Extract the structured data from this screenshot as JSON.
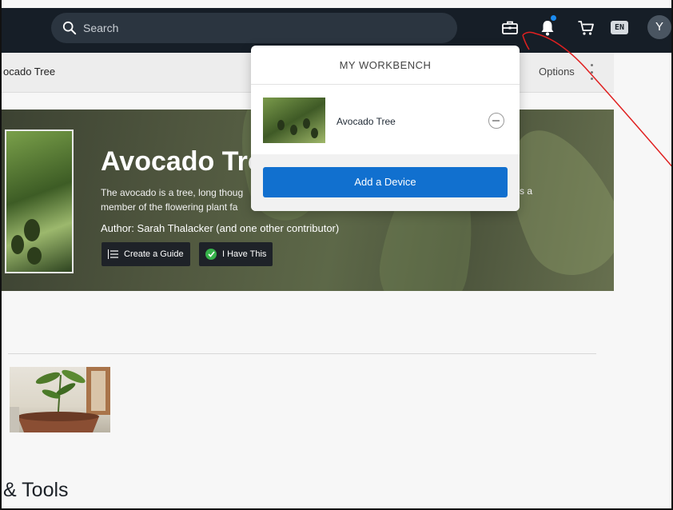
{
  "header": {
    "search_placeholder": "Search",
    "icons": [
      "search-icon",
      "toolbox-icon",
      "bell-icon",
      "cart-icon"
    ],
    "notification_dot_color": "#1b8bf0",
    "language": "EN",
    "avatar_initial": "Y"
  },
  "subbar": {
    "breadcrumb": "ocado Tree",
    "options_label": "Options"
  },
  "hero": {
    "title": "Avocado Tre",
    "description_line1": "The avocado is a tree, long thoug",
    "description_line2": "member of the flowering plant fa",
    "description_tail": "s a",
    "author": "Author: Sarah Thalacker (and one other contributor)",
    "create_guide_label": "Create a Guide",
    "have_this_label": "I Have This"
  },
  "content": {
    "tools_heading": "& Tools"
  },
  "workbench": {
    "title": "MY WORKBENCH",
    "item_name": "Avocado Tree",
    "add_device_label": "Add a Device",
    "button_color": "#1170cf"
  },
  "annotation": {
    "color": "#e02020"
  }
}
